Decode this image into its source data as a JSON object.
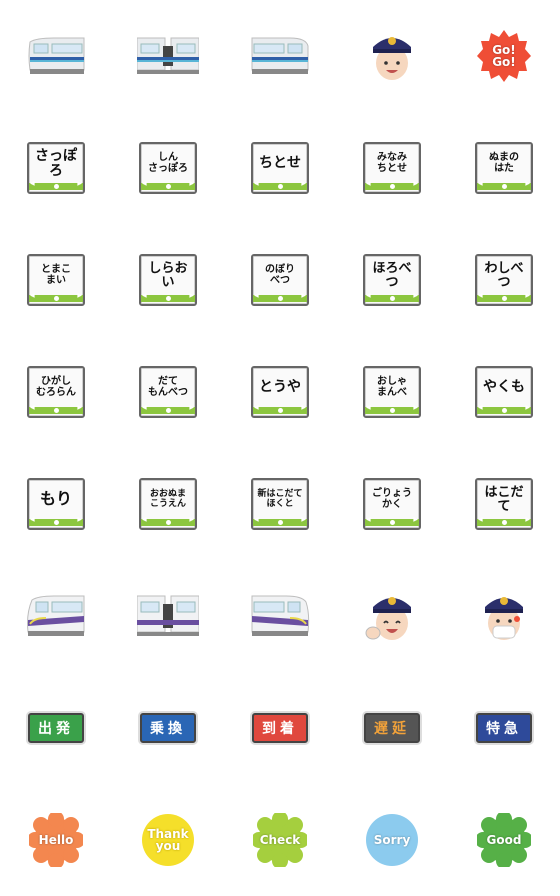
{
  "colors": {
    "sign_green": "#8cc63f",
    "train_blue": "#2f5fa8",
    "train_purple": "#6a4fa0",
    "cap_navy": "#2b2f6b"
  },
  "row1": {
    "go_badge": "Go!\nGo!"
  },
  "stations_row2": [
    "さっぽろ",
    "しん\nさっぽろ",
    "ちとせ",
    "みなみ\nちとせ",
    "ぬまの\nはた"
  ],
  "stations_row3": [
    "とまこ\nまい",
    "しらおい",
    "のぼり\nべつ",
    "ほろべつ",
    "わしべつ"
  ],
  "stations_row4": [
    "ひがし\nむろらん",
    "だて\nもんべつ",
    "とうや",
    "おしゃ\nまんべ",
    "やくも"
  ],
  "stations_row5": [
    "もり",
    "おおぬま\nこうえん",
    "新はこだて\nほくと",
    "ごりょう\nかく",
    "はこだて"
  ],
  "status_badges": [
    {
      "label": "出発",
      "color": "#3aa14a"
    },
    {
      "label": "乗換",
      "color": "#2a66b5"
    },
    {
      "label": "到着",
      "color": "#e0483e"
    },
    {
      "label": "遅延",
      "color": "#555555",
      "text_color": "#f2a23a"
    },
    {
      "label": "特急",
      "color": "#2e4a9a"
    }
  ],
  "flower_badges": [
    {
      "label": "Hello",
      "color": "#f3874f"
    },
    {
      "label": "Thank\nyou",
      "color": "#f5df2a"
    },
    {
      "label": "Check",
      "color": "#a5cf3e"
    },
    {
      "label": "Sorry",
      "color": "#8ccbee"
    },
    {
      "label": "Good",
      "color": "#56b047"
    }
  ]
}
